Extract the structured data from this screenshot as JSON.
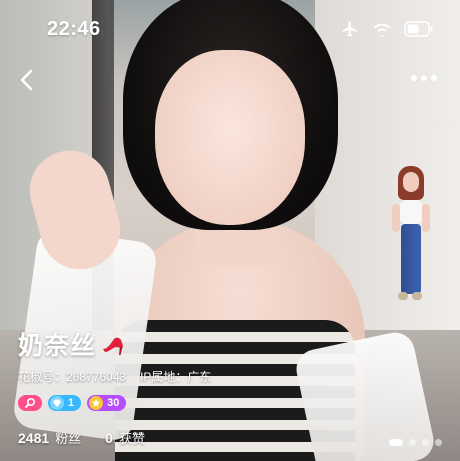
{
  "status_bar": {
    "time": "22:46",
    "icons": [
      "airplane-icon",
      "wifi-icon",
      "battery-icon"
    ]
  },
  "nav": {
    "back_icon": "chevron-left-icon",
    "more_icon": "more-horizontal-icon"
  },
  "profile": {
    "name": "奶奈丝",
    "name_badge_icon": "high-heel-icon",
    "id_text": "花椒号：268776043",
    "ip_text": "IP属地：广东",
    "badges": [
      {
        "icon": "search-icon",
        "value": "",
        "color": "#ff4f8a"
      },
      {
        "icon": "diamond-icon",
        "value": "1",
        "color": "#38b7ff"
      },
      {
        "icon": "star-icon",
        "value": "30",
        "color": "#b64dff"
      }
    ],
    "stats": [
      {
        "value": "2481",
        "label": "粉丝"
      },
      {
        "value": "0",
        "label": "获赞"
      }
    ]
  },
  "pager": {
    "total": 4,
    "active": 1
  }
}
